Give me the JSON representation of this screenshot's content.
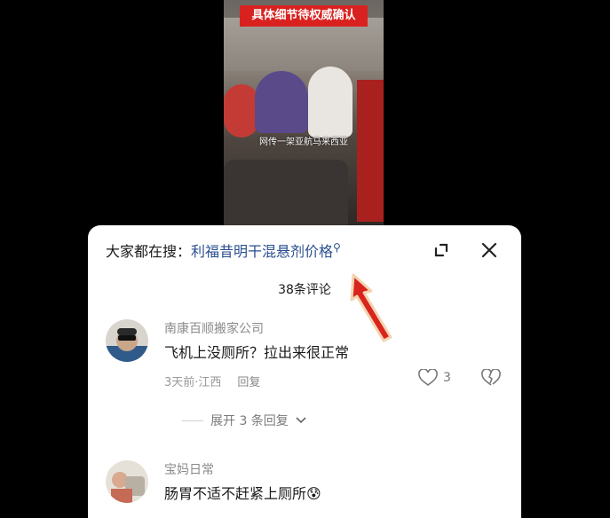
{
  "video": {
    "title_banner": "具体细节待权威确认",
    "caption": "网传一架亚航马来西亚"
  },
  "sheet": {
    "search_prefix": "大家都在搜：",
    "search_term": "利福昔明干混悬剂价格",
    "comment_count": "38条评论"
  },
  "comments": [
    {
      "username": "南康百顺搬家公司",
      "text": "飞机上没厕所？拉出来很正常",
      "time_location": "3天前·江西",
      "reply_label": "回复",
      "likes": "3",
      "expand_replies": "展开 3 条回复"
    },
    {
      "username": "宝妈日常",
      "text": "肠胃不适不赶紧上厕所😰"
    }
  ],
  "colors": {
    "accent_link": "#2b4f8f",
    "annotation_arrow": "#d9231d",
    "banner_red": "#d9221f"
  },
  "icons": [
    "search-icon",
    "expand-icon",
    "close-icon",
    "heart-icon",
    "broken-heart-icon",
    "chevron-down-icon"
  ]
}
